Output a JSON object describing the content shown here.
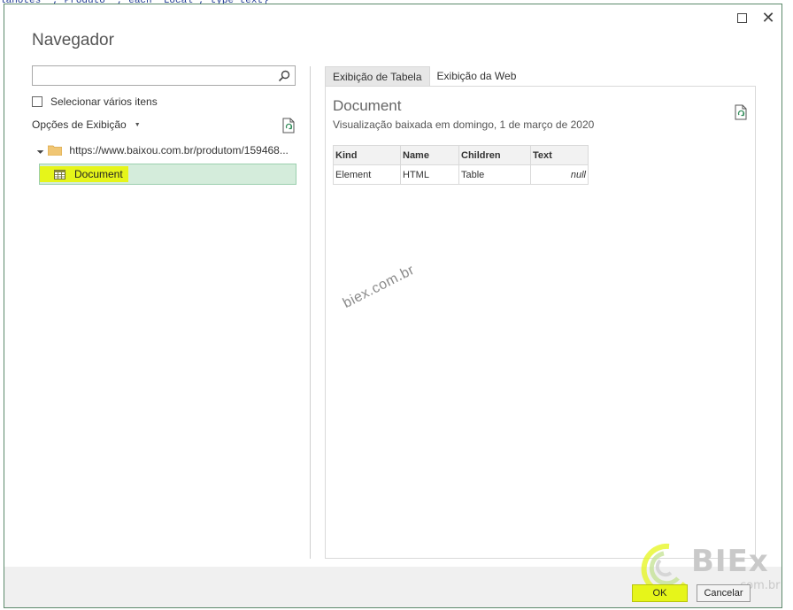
{
  "code_line": "lanotes \", Produto \", each \"Local\", type text}",
  "window": {
    "title": "Navegador",
    "maximize_label": "",
    "close_label": "✕"
  },
  "left_panel": {
    "search": {
      "value": "",
      "placeholder": ""
    },
    "multi_select_label": "Selecionar vários itens",
    "view_options_label": "Opções de Exibição",
    "tree": {
      "root_label": "https://www.baixou.com.br/produtom/159468...",
      "child_label": "Document"
    }
  },
  "right_panel": {
    "tabs": [
      {
        "label": "Exibição de Tabela",
        "active": true
      },
      {
        "label": "Exibição da Web",
        "active": false
      }
    ],
    "preview_title": "Document",
    "preview_subtitle": "Visualização baixada em domingo, 1 de março de 2020",
    "table": {
      "columns": [
        "Kind",
        "Name",
        "Children",
        "Text"
      ],
      "rows": [
        [
          "Element",
          "HTML",
          "Table",
          "null"
        ]
      ]
    },
    "watermark": "biex.com.br"
  },
  "footer": {
    "ok_label": "OK",
    "cancel_label": "Cancelar"
  },
  "logo": {
    "text": "BIEx",
    "sub": "com.br"
  },
  "colors": {
    "highlight": "#e6f51a",
    "selected_bg": "#d4ecdb",
    "border": "#5c8a6b"
  },
  "icons": {
    "search": "search-icon",
    "refresh": "refresh-icon",
    "folder": "folder-icon",
    "table": "table-icon"
  }
}
